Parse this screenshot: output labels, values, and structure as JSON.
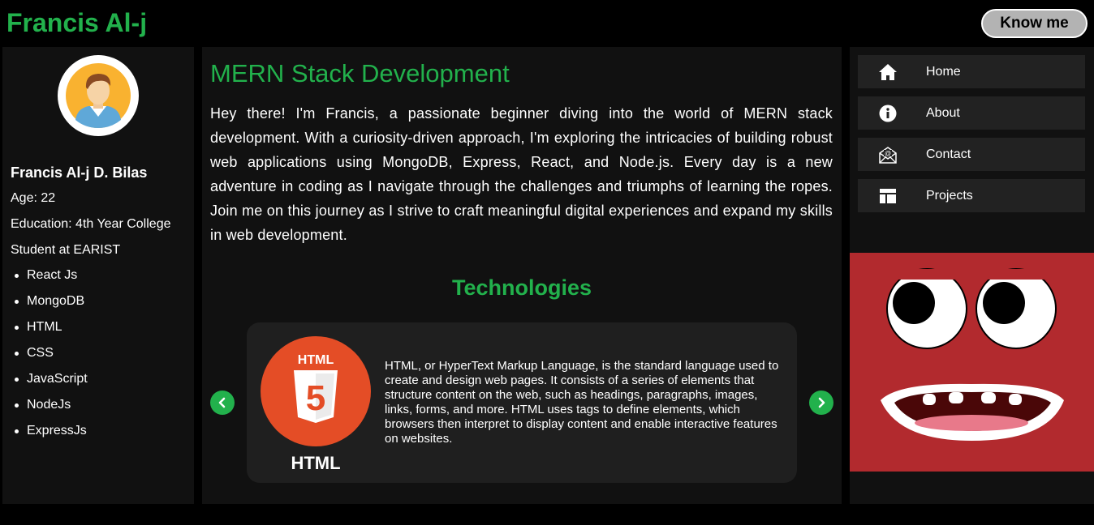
{
  "header": {
    "brand": "Francis Al-j",
    "know_me_label": "Know me"
  },
  "profile": {
    "avatar_icon": "user-avatar-icon",
    "name": "Francis Al-j D. Bilas",
    "age": "Age: 22",
    "education": "Education: 4th Year College",
    "school": "Student at EARIST",
    "skills": [
      "React Js",
      "MongoDB",
      "HTML",
      "CSS",
      "JavaScript",
      "NodeJs",
      "ExpressJs"
    ]
  },
  "main": {
    "title": "MERN Stack Development",
    "intro": "Hey there! I'm Francis, a passionate beginner diving into the world of MERN stack development. With a curiosity-driven approach, I'm exploring the intricacies of building robust web applications using MongoDB, Express, React, and Node.js. Every day is a new adventure in coding as I navigate through the challenges and triumphs of learning the ropes. Join me on this journey as I strive to craft meaningful digital experiences and expand my skills in web development.",
    "technologies_title": "Technologies",
    "carousel": {
      "current": {
        "name": "HTML",
        "logo_text": "HTML",
        "logo_number": "5",
        "description": "HTML, or HyperText Markup Language, is the standard language used to create and design web pages. It consists of a series of elements that structure content on the web, such as headings, paragraphs, images, links, forms, and more. HTML uses tags to define elements, which browsers then interpret to display content and enable interactive features on websites."
      },
      "prev_icon": "chevron-left-icon",
      "next_icon": "chevron-right-icon"
    }
  },
  "nav": {
    "items": [
      {
        "label": "Home",
        "icon": "home-icon"
      },
      {
        "label": "About",
        "icon": "info-icon"
      },
      {
        "label": "Contact",
        "icon": "mail-icon"
      },
      {
        "label": "Projects",
        "icon": "layout-icon"
      }
    ]
  },
  "colors": {
    "accent": "#22b14c",
    "background": "#000000",
    "panel": "#111111",
    "card": "#1f1f1f",
    "html_orange": "#e44d26",
    "monster_red": "#b22a2e"
  }
}
